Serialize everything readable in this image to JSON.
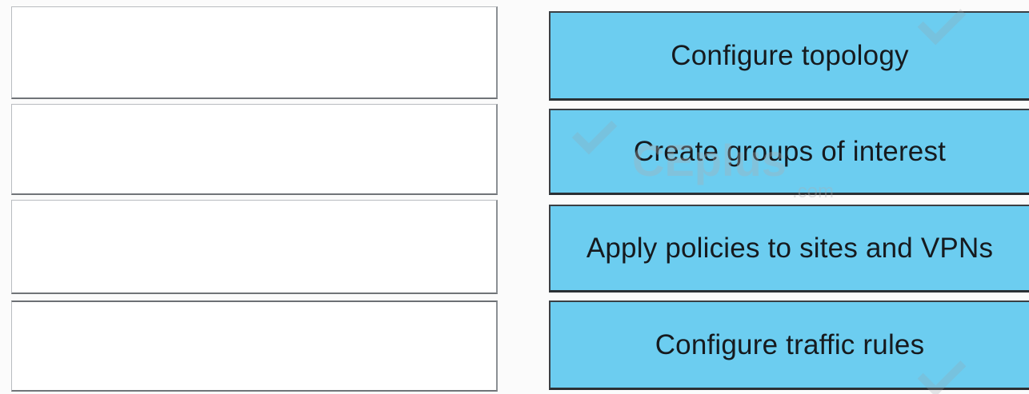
{
  "answer_slots": [
    {
      "id": "slot1",
      "value": ""
    },
    {
      "id": "slot2",
      "value": ""
    },
    {
      "id": "slot3",
      "value": ""
    },
    {
      "id": "slot4",
      "value": ""
    }
  ],
  "options": [
    {
      "label": "Configure topology"
    },
    {
      "label": "Create groups of interest"
    },
    {
      "label": "Apply policies to sites and VPNs"
    },
    {
      "label": "Configure traffic rules"
    }
  ],
  "watermark": {
    "brand": "CEplus",
    "domain": ".com"
  },
  "colors": {
    "tile": "#6ccdf0",
    "slot": "#ffffff"
  }
}
